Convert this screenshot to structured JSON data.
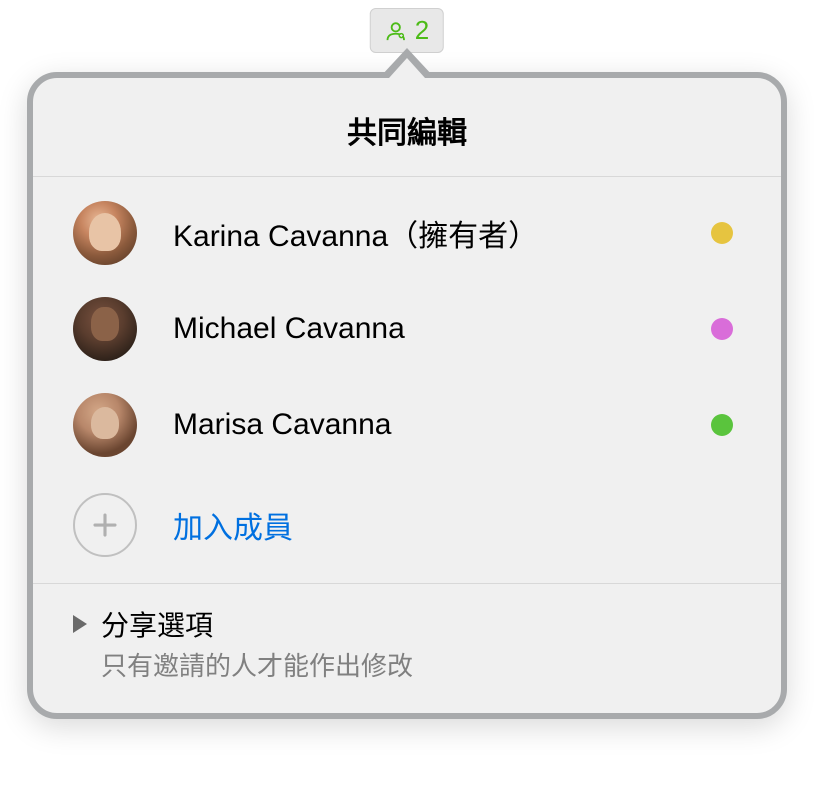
{
  "toolbar": {
    "participant_count": "2"
  },
  "popover": {
    "title": "共同編輯",
    "participants": [
      {
        "name": "Karina Cavanna（擁有者）",
        "color": "#e6c440"
      },
      {
        "name": "Michael Cavanna",
        "color": "#d96dd9"
      },
      {
        "name": "Marisa Cavanna",
        "color": "#5ac43d"
      }
    ],
    "add_member_label": "加入成員",
    "share_options": {
      "title": "分享選項",
      "subtitle": "只有邀請的人才能作出修改"
    }
  }
}
